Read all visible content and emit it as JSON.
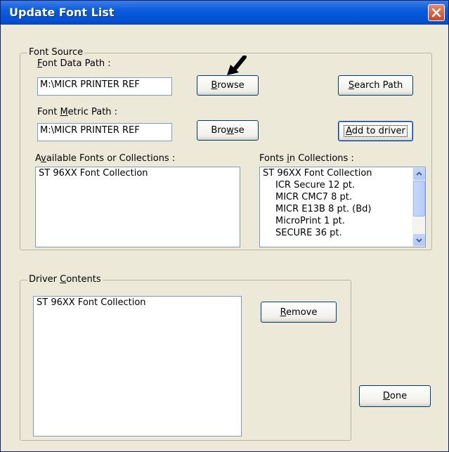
{
  "window": {
    "title": "Update Font List"
  },
  "font_source": {
    "legend": "Font Source",
    "font_data_path": {
      "label": "Font Data Path :",
      "value": "M:\\MICR PRINTER REF"
    },
    "font_metric_path": {
      "label": "Font Metric Path :",
      "value": "M:\\MICR PRINTER REF"
    },
    "browse_label": "Browse",
    "search_path_label": "Search Path",
    "add_to_driver_label": "Add to driver",
    "available": {
      "label": "Available Fonts or Collections :",
      "items": [
        "ST 96XX Font Collection"
      ]
    },
    "collections": {
      "label": "Fonts in Collections :",
      "items": [
        "ST 96XX Font Collection",
        "ICR Secure 12 pt.",
        "MICR CMC7 8 pt.",
        "MICR E13B 8 pt. (Bd)",
        "MicroPrint 1 pt.",
        "SECURE 36 pt."
      ]
    }
  },
  "driver_contents": {
    "legend": "Driver Contents",
    "items": [
      "ST 96XX Font Collection"
    ],
    "remove_label": "Remove"
  },
  "done_label": "Done",
  "icons": {
    "close": "close-icon",
    "pointer": "arrow-pointer-icon",
    "scroll_up": "chevron-up-icon",
    "scroll_down": "chevron-down-icon"
  }
}
